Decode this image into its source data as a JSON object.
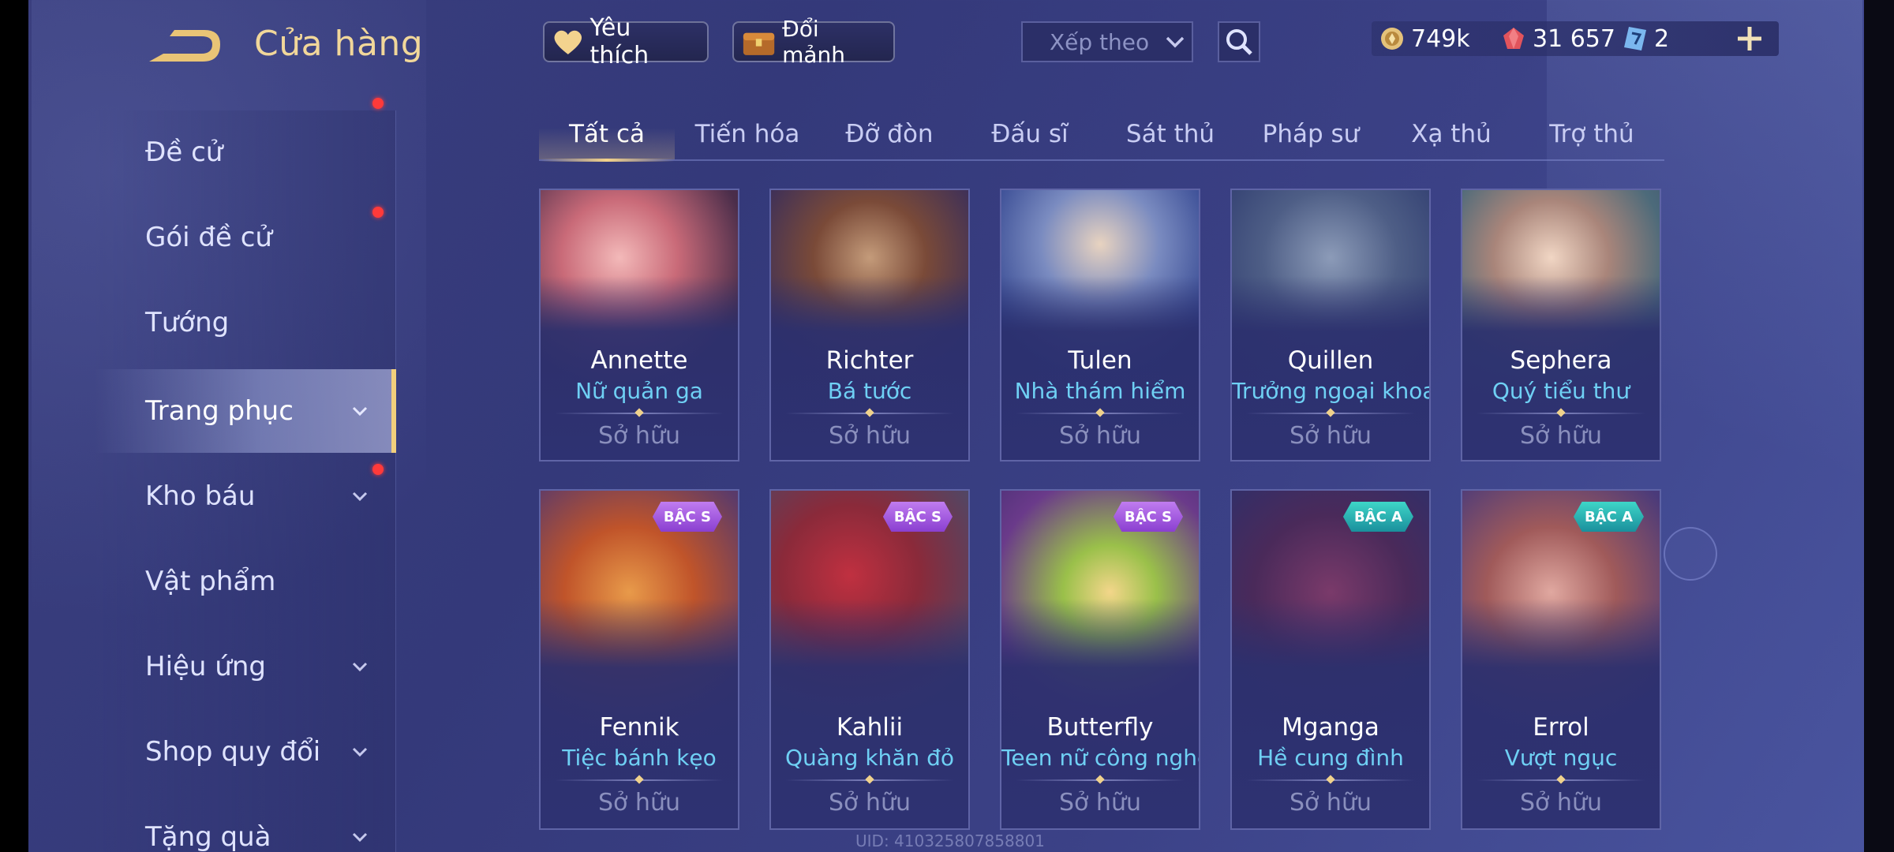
{
  "header": {
    "title": "Cửa hàng",
    "favorite_label": "Yêu thích",
    "exchange_label": "Đổi mảnh",
    "sort_placeholder": "Xếp theo"
  },
  "currency": {
    "gold": "749k",
    "vouchers": "31 657",
    "tickets": "2"
  },
  "sidebar": {
    "items": [
      {
        "label": "Đề cử"
      },
      {
        "label": "Gói đề cử"
      },
      {
        "label": "Tướng"
      },
      {
        "label": "Trang phục"
      },
      {
        "label": "Kho báu"
      },
      {
        "label": "Vật phẩm"
      },
      {
        "label": "Hiệu ứng"
      },
      {
        "label": "Shop quy đổi"
      },
      {
        "label": "Tặng quà"
      }
    ]
  },
  "tabs": [
    "Tất cả",
    "Tiến hóa",
    "Đỡ đòn",
    "Đấu sĩ",
    "Sát thủ",
    "Pháp sư",
    "Xạ thủ",
    "Trợ thủ"
  ],
  "cards": [
    {
      "hero": "Annette",
      "skin": "Nữ quản ga",
      "status": "Sở hữu",
      "tier": ""
    },
    {
      "hero": "Richter",
      "skin": "Bá tước",
      "status": "Sở hữu",
      "tier": ""
    },
    {
      "hero": "Tulen",
      "skin": "Nhà thám hiểm",
      "status": "Sở hữu",
      "tier": ""
    },
    {
      "hero": "Quillen",
      "skin": "Trưởng ngoại khoa",
      "status": "Sở hữu",
      "tier": ""
    },
    {
      "hero": "Sephera",
      "skin": "Quý tiểu thư",
      "status": "Sở hữu",
      "tier": ""
    },
    {
      "hero": "Fennik",
      "skin": "Tiệc bánh kẹo",
      "status": "Sở hữu",
      "tier": "BẬC S"
    },
    {
      "hero": "Kahlii",
      "skin": "Quàng khăn đỏ",
      "status": "Sở hữu",
      "tier": "BẬC S"
    },
    {
      "hero": "Butterfly",
      "skin": "Teen nữ công nghệ",
      "status": "Sở hữu",
      "tier": "BẬC S"
    },
    {
      "hero": "Mganga",
      "skin": "Hề cung đình",
      "status": "Sở hữu",
      "tier": "BẬC A"
    },
    {
      "hero": "Errol",
      "skin": "Vượt ngục",
      "status": "Sở hữu",
      "tier": "BẬC A"
    }
  ],
  "footer": {
    "uid": "UID: 410325807858801"
  },
  "colors": {
    "accent_gold": "#f2cf7c",
    "skin_name": "#6fd0f4",
    "notification": "#ff3a3a",
    "tier_s": "#a85be0",
    "tier_a": "#27b3b5"
  }
}
